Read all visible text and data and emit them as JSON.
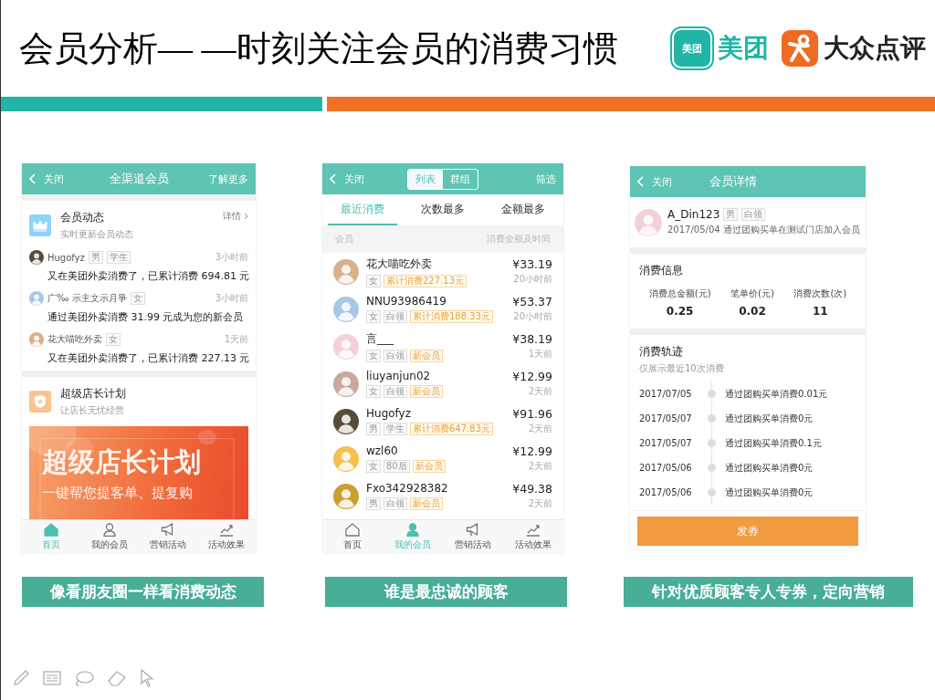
{
  "title": "会员分析— —时刻关注会员的消费习惯",
  "logos": [
    {
      "kind": "meituan",
      "badge": "美团",
      "name": "美团"
    },
    {
      "kind": "dianping",
      "name": "大众点评"
    }
  ],
  "feed_screen": {
    "header": {
      "back": "关闭",
      "title": "全渠道会员",
      "action": "了解更多"
    },
    "activity": {
      "title": "会员动态",
      "subtitle": "实时更新会员动态",
      "link": "详情"
    },
    "feed": [
      {
        "name": "Hugofyz",
        "tags": [
          "男",
          "学生"
        ],
        "time": "3小时前",
        "message": "又在美团外卖消费了，已累计消费 694.81 元"
      },
      {
        "name": "广‰ 示主文示月爭",
        "tags": [
          "女"
        ],
        "time": "3小时前",
        "message": "通过美团外卖消费 31.99 元成为您的新会员"
      },
      {
        "name": "花大喵吃外卖",
        "tags": [
          "女"
        ],
        "time": "1天前",
        "message": "又在美团外卖消费了，已累计消费 227.13 元"
      }
    ],
    "plan": {
      "title": "超级店长计划",
      "subtitle": "让店长无忧经营"
    },
    "banner": {
      "title": "超级店长计划",
      "subtitle": "一键帮您提客单、提复购"
    },
    "tabbar": [
      {
        "label": "首页",
        "selected": true
      },
      {
        "label": "我的会员",
        "selected": false
      },
      {
        "label": "营销活动",
        "selected": false
      },
      {
        "label": "活动效果",
        "selected": false
      }
    ],
    "caption": "像看朋友圈一样看消费动态"
  },
  "members_screen": {
    "header": {
      "back": "关闭",
      "segments": [
        {
          "label": "列表",
          "selected": true
        },
        {
          "label": "群组",
          "selected": false
        }
      ],
      "action": "筛选"
    },
    "sort_tabs": [
      {
        "label": "最近消费",
        "selected": true
      },
      {
        "label": "次数最多",
        "selected": false
      },
      {
        "label": "金额最多",
        "selected": false
      }
    ],
    "columns": [
      "会员",
      "消费金额及时间"
    ],
    "rows": [
      {
        "name": "花大喵吃外卖",
        "tags": [
          {
            "label": "女",
            "kind": "plain"
          },
          {
            "label": "累计消费227.13元",
            "kind": "highlight"
          }
        ],
        "amount": "¥33.19",
        "time": "20小时前"
      },
      {
        "name": "NNU93986419",
        "tags": [
          {
            "label": "女",
            "kind": "plain"
          },
          {
            "label": "白领",
            "kind": "plain"
          },
          {
            "label": "累计消费188.33元",
            "kind": "highlight"
          }
        ],
        "amount": "¥53.37",
        "time": "20小时前"
      },
      {
        "name": "言___",
        "tags": [
          {
            "label": "女",
            "kind": "plain"
          },
          {
            "label": "白领",
            "kind": "plain"
          },
          {
            "label": "新会员",
            "kind": "highlight"
          }
        ],
        "amount": "¥38.19",
        "time": "1天前"
      },
      {
        "name": "liuyanjun02",
        "tags": [
          {
            "label": "女",
            "kind": "plain"
          },
          {
            "label": "白领",
            "kind": "plain"
          },
          {
            "label": "新会员",
            "kind": "highlight"
          }
        ],
        "amount": "¥12.99",
        "time": "2天前"
      },
      {
        "name": "Hugofyz",
        "tags": [
          {
            "label": "男",
            "kind": "plain"
          },
          {
            "label": "学生",
            "kind": "plain"
          },
          {
            "label": "累计消费647.83元",
            "kind": "highlight"
          }
        ],
        "amount": "¥91.96",
        "time": "2天前"
      },
      {
        "name": "wzl60",
        "tags": [
          {
            "label": "女",
            "kind": "plain"
          },
          {
            "label": "80后",
            "kind": "plain"
          },
          {
            "label": "新会员",
            "kind": "highlight"
          }
        ],
        "amount": "¥12.99",
        "time": "2天前"
      },
      {
        "name": "Fxo342928382",
        "tags": [
          {
            "label": "男",
            "kind": "plain"
          },
          {
            "label": "白领",
            "kind": "plain"
          },
          {
            "label": "新会员",
            "kind": "highlight"
          }
        ],
        "amount": "¥49.38",
        "time": "2天前"
      }
    ],
    "tabbar": [
      {
        "label": "首页",
        "selected": false
      },
      {
        "label": "我的会员",
        "selected": true
      },
      {
        "label": "营销活动",
        "selected": false
      },
      {
        "label": "活动效果",
        "selected": false
      }
    ],
    "caption": "谁是最忠诚的顾客"
  },
  "detail_screen": {
    "header": {
      "back": "关闭",
      "title": "会员详情"
    },
    "member": {
      "name": "A_Din123",
      "tags": [
        "男",
        "白领"
      ],
      "joined": "2017/05/04 通过团购买单在测试门店加入会员"
    },
    "info": {
      "title": "消费信息",
      "stats": [
        {
          "label": "消费总金额(元)",
          "value": "0.25"
        },
        {
          "label": "笔单价(元)",
          "value": "0.02"
        },
        {
          "label": "消费次数(次)",
          "value": "11"
        }
      ]
    },
    "track": {
      "title": "消费轨迹",
      "note": "仅展示最近10次消费",
      "items": [
        {
          "date": "2017/07/05",
          "text": "通过团购买单消费0.01元"
        },
        {
          "date": "2017/05/07",
          "text": "通过团购买单消费0元"
        },
        {
          "date": "2017/05/07",
          "text": "通过团购买单消费0.1元"
        },
        {
          "date": "2017/05/06",
          "text": "通过团购买单消费0元"
        },
        {
          "date": "2017/05/06",
          "text": "通过团购买单消费0元"
        }
      ]
    },
    "button": "发券",
    "caption": "针对优质顾客专人专券，定向营销"
  }
}
